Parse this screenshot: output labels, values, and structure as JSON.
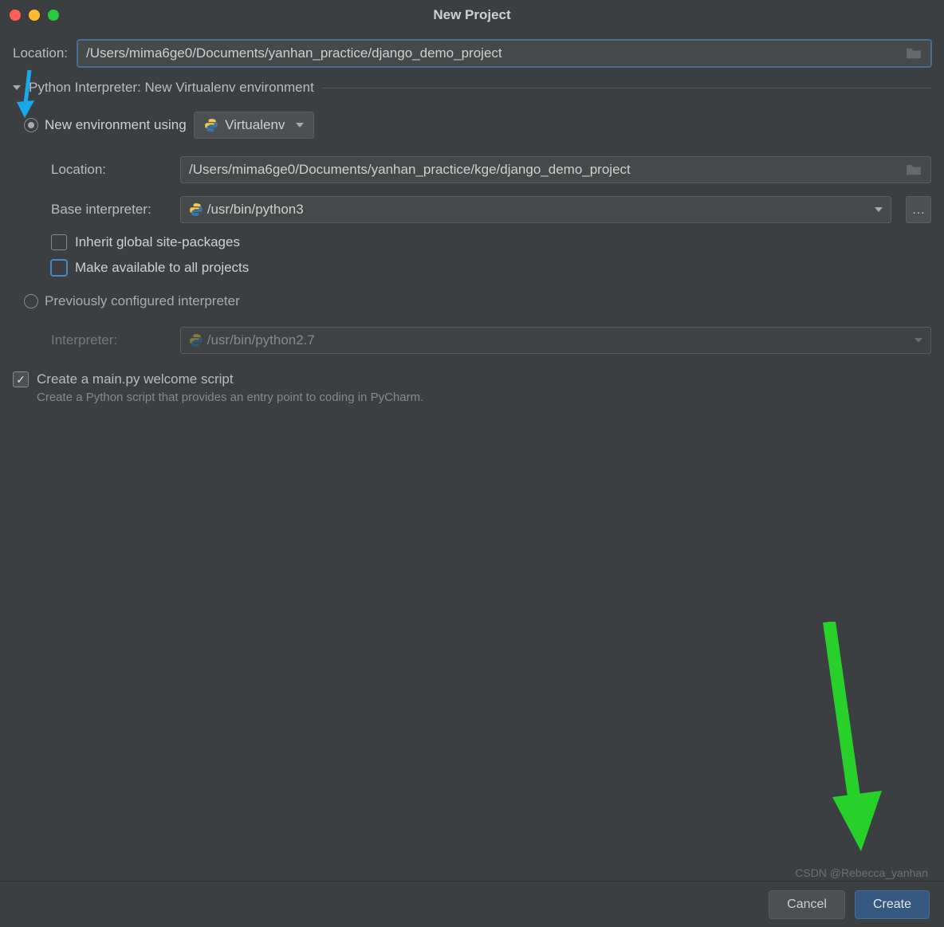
{
  "window": {
    "title": "New Project"
  },
  "location": {
    "label": "Location:",
    "value": "/Users/mima6ge0/Documents/yanhan_practice/django_demo_project"
  },
  "interpreter_section": {
    "heading": "Python Interpreter: New Virtualenv environment"
  },
  "new_env": {
    "radio_label": "New environment using",
    "tool": "Virtualenv",
    "location_label": "Location:",
    "location_value": "/Users/mima6ge0/Documents/yanhan_practice/kge/django_demo_project",
    "base_label": "Base interpreter:",
    "base_value": "/usr/bin/python3",
    "inherit_label": "Inherit global site-packages",
    "available_label": "Make available to all projects"
  },
  "prev_env": {
    "radio_label": "Previously configured interpreter",
    "interpreter_label": "Interpreter:",
    "interpreter_value": "/usr/bin/python2.7"
  },
  "main_py": {
    "label": "Create a main.py welcome script",
    "desc": "Create a Python script that provides an entry point to coding in PyCharm."
  },
  "buttons": {
    "cancel": "Cancel",
    "create": "Create"
  },
  "browse_icon": "folder-icon",
  "watermark": "CSDN @Rebecca_yanhan"
}
